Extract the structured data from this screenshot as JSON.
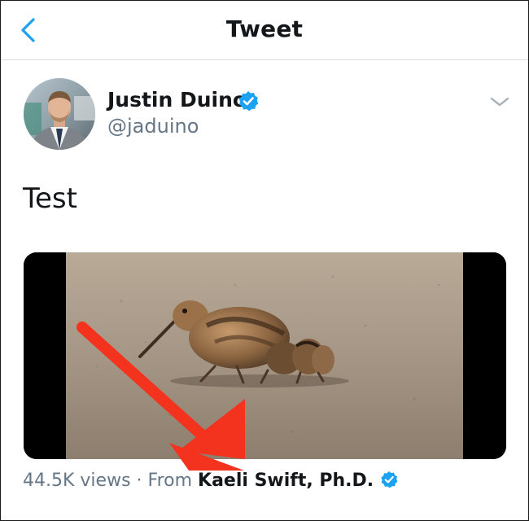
{
  "header": {
    "title": "Tweet",
    "back_icon": "chevron-left-icon",
    "accent_color": "#1da1f2"
  },
  "tweet": {
    "author": {
      "display_name": "Justin Duino",
      "handle": "@jaduino",
      "verified": true,
      "verified_icon": "verified-badge-icon"
    },
    "more_icon": "chevron-down-icon",
    "text": "Test",
    "media": {
      "kind": "video",
      "description_icon": "video-thumbnail"
    },
    "media_footer": {
      "views": "44.5K views",
      "separator": " · ",
      "from_label": "From ",
      "source_name": "Kaeli Swift, Ph.D.",
      "source_verified": true
    }
  },
  "annotation": {
    "arrow_color": "#f4331f",
    "arrow_icon": "red-arrow-annotation"
  },
  "colors": {
    "text_primary": "#14171a",
    "text_secondary": "#657786",
    "verified_blue": "#1da1f2"
  }
}
